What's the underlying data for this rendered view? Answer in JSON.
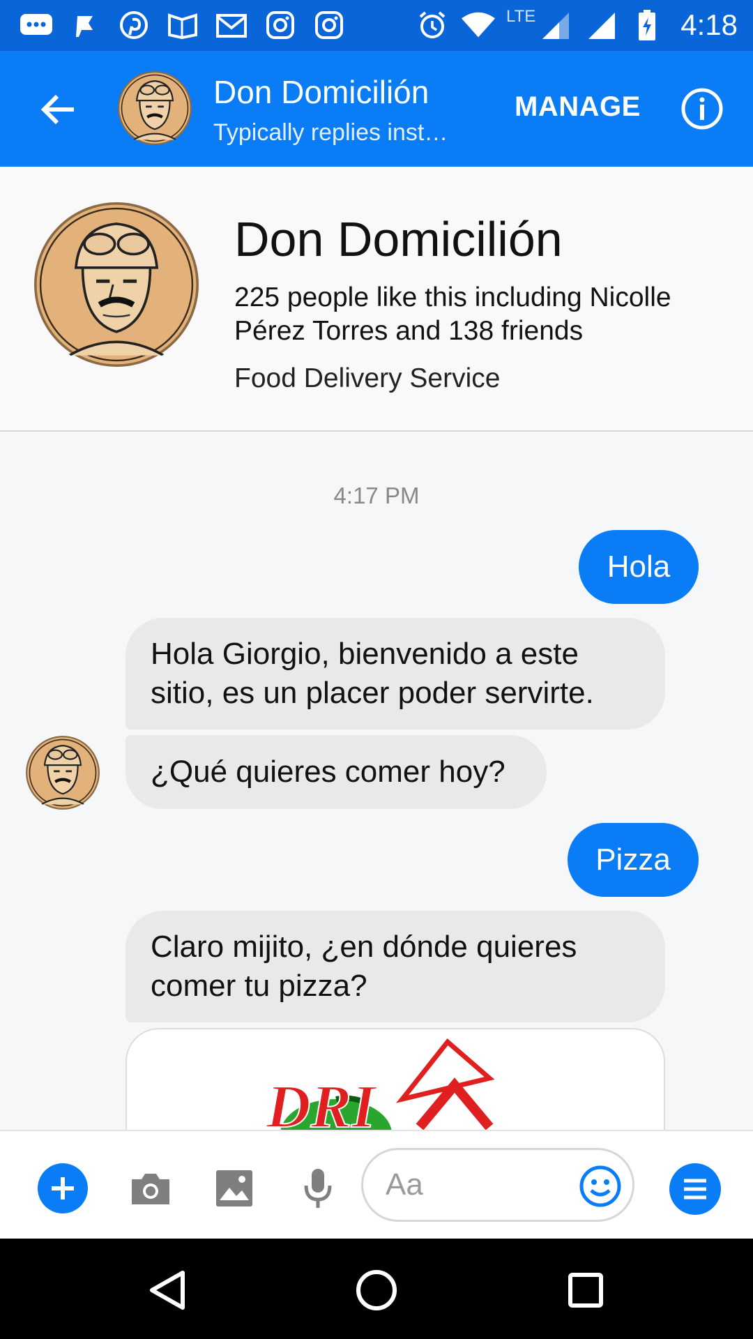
{
  "status_bar": {
    "time": "4:18",
    "network": "LTE"
  },
  "header": {
    "title": "Don Domicilión",
    "subtitle": "Typically replies instantly",
    "manage_label": "MANAGE"
  },
  "page": {
    "name": "Don Domicilión",
    "likes": "225 people like this including Nicolle Pérez Torres and 138 friends",
    "category": "Food Delivery Service"
  },
  "chat": {
    "timestamp": "4:17 PM",
    "messages": [
      {
        "from": "me",
        "text": "Hola"
      },
      {
        "from": "page",
        "text": "Hola Giorgio, bienvenido a este sitio, es un placer poder servirte."
      },
      {
        "from": "page",
        "text": "¿Qué quieres comer hoy?"
      },
      {
        "from": "me",
        "text": "Pizza"
      },
      {
        "from": "page",
        "text": "Claro mijito, ¿en dónde quieres comer tu pizza?"
      }
    ],
    "image_card_logo": "DRIVE"
  },
  "composer": {
    "placeholder": "Aa"
  },
  "colors": {
    "accent": "#0a7cf6",
    "status_bar": "#0a65d8",
    "incoming_bubble": "#e9e9eb"
  }
}
